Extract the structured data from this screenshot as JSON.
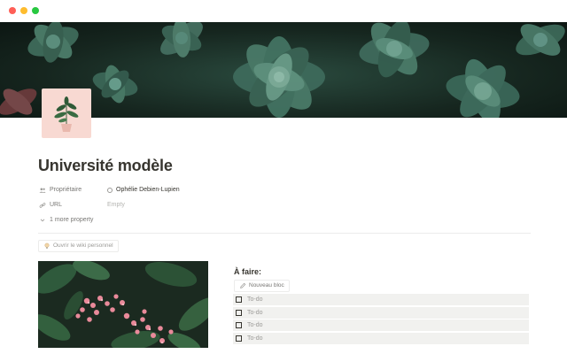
{
  "window": {
    "controls": [
      "close",
      "minimize",
      "zoom"
    ]
  },
  "page": {
    "title": "Université modèle",
    "icon": "potted-plant-icon"
  },
  "properties": [
    {
      "icon": "people-icon",
      "name": "Propriétaire",
      "value": "Ophélie Debien-Lupien"
    },
    {
      "icon": "link-icon",
      "name": "URL",
      "value": "Empty"
    }
  ],
  "more_properties_label": "1 more property",
  "wiki_button": {
    "icon": "lightbulb-icon",
    "label": "Ouvrir le wiki personnel"
  },
  "todo": {
    "heading": "À faire:",
    "new_block_icon": "pencil-icon",
    "new_block_label": "Nouveau bloc",
    "items": [
      "To-do",
      "To-do",
      "To-do",
      "To-do"
    ]
  },
  "colors": {
    "text": "#37352f",
    "muted": "#787774",
    "icon_bg": "#f8d9d2",
    "todo_bg": "#f1f1ef",
    "close": "#ff5f57",
    "minimize": "#febc2e",
    "zoom": "#28c840"
  }
}
